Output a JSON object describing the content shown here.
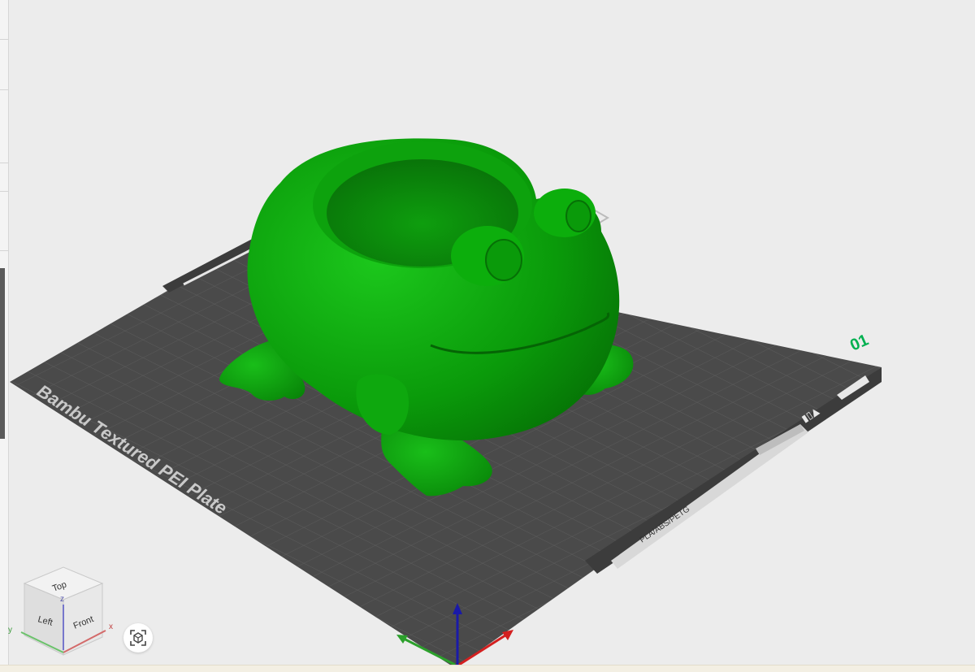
{
  "plate": {
    "name": "Bambu Textured PEI Plate",
    "plate_number": "01",
    "filament_label": "PLA/ABS/PETG"
  },
  "model": {
    "name": "frog planter",
    "color": "#0fa10f"
  },
  "view_cube": {
    "top": "Top",
    "front": "Front",
    "left": "Left",
    "axis_x": "x",
    "axis_y": "y",
    "axis_z": "z"
  },
  "colors": {
    "plate": "#4a4a4a",
    "plate_number": "#00b050",
    "axis_x": "#d32020",
    "axis_y": "#2ca02c",
    "axis_z": "#1a1aa8",
    "background": "#ececec"
  },
  "icons": {
    "camera_reset": "camera-reset-icon"
  }
}
